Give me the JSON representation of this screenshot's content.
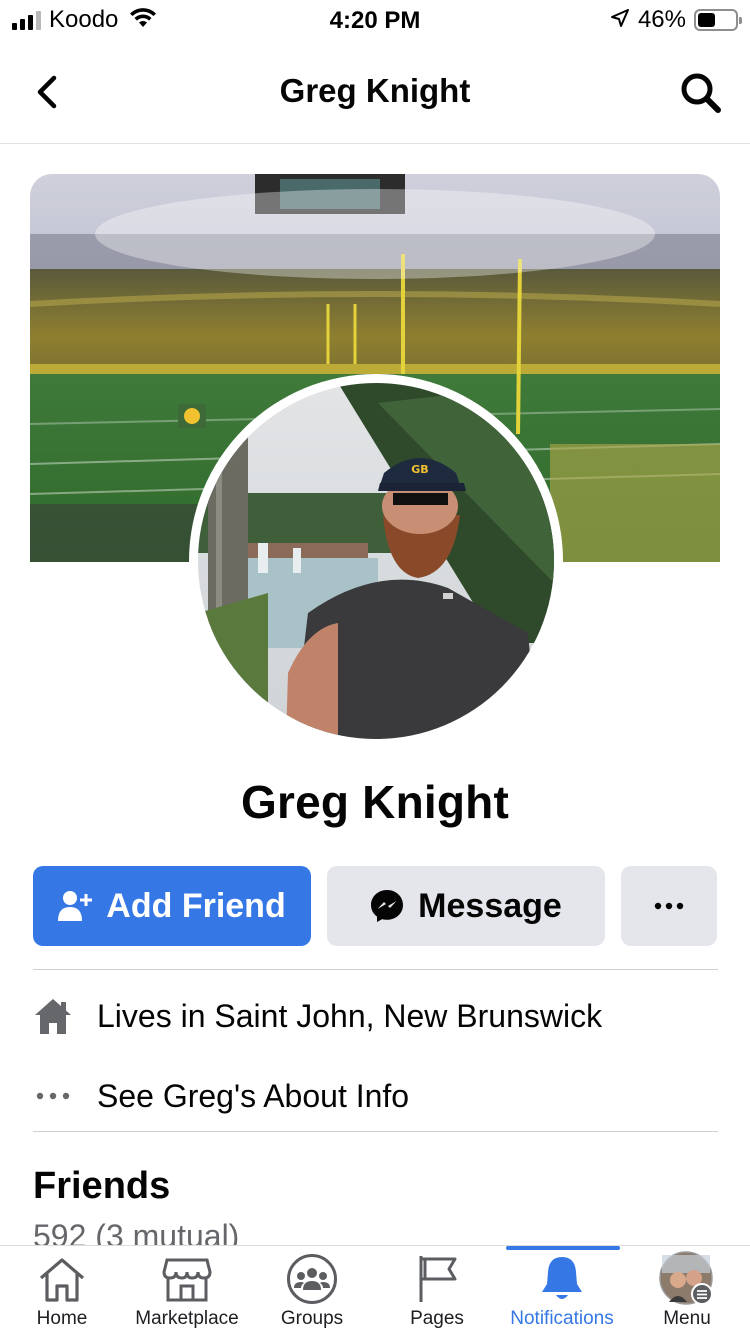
{
  "status_bar": {
    "carrier": "Koodo",
    "time": "4:20 PM",
    "battery_percent": "46%",
    "battery_level": 0.46,
    "signal_bars_filled": 3,
    "signal_bars_total": 4
  },
  "nav": {
    "title": "Greg Knight",
    "back_icon": "chevron-left-icon",
    "search_icon": "search-icon"
  },
  "profile": {
    "name": "Greg Knight"
  },
  "actions": {
    "add_friend_label": "Add Friend",
    "message_label": "Message",
    "more_label": "···"
  },
  "info": {
    "lives_prefix": "Lives in ",
    "lives_location": "Saint John, New Brunswick",
    "about_label": "See Greg's About Info"
  },
  "friends": {
    "title": "Friends",
    "count": "592 (3 mutual)"
  },
  "tabs": [
    {
      "label": "Home",
      "icon": "home-icon",
      "active": false
    },
    {
      "label": "Marketplace",
      "icon": "marketplace-icon",
      "active": false
    },
    {
      "label": "Groups",
      "icon": "groups-icon",
      "active": false
    },
    {
      "label": "Pages",
      "icon": "pages-flag-icon",
      "active": false
    },
    {
      "label": "Notifications",
      "icon": "bell-icon",
      "active": true
    },
    {
      "label": "Menu",
      "icon": "avatar-menu-icon",
      "active": false
    }
  ],
  "colors": {
    "accent": "#3578e5",
    "secondary_button": "#e4e6eb",
    "text": "#050505"
  }
}
